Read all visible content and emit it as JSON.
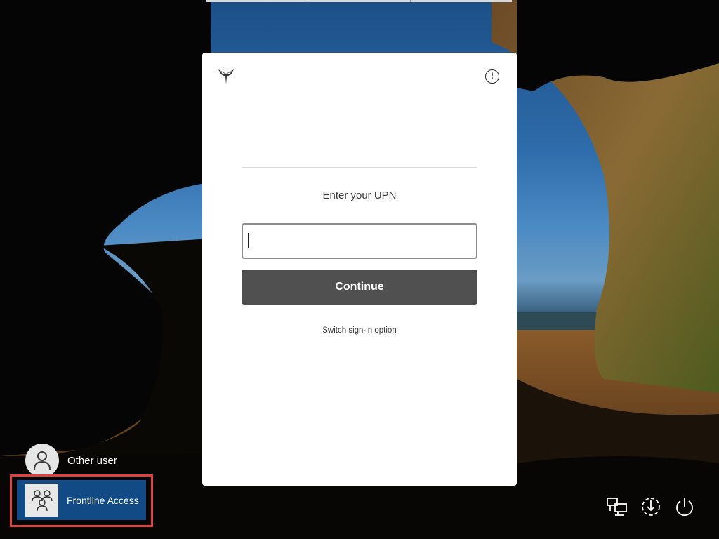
{
  "signin": {
    "prompt": "Enter your UPN",
    "upn_value": "",
    "continue_label": "Continue",
    "switch_label": "Switch sign-in option"
  },
  "users": [
    {
      "name": "Other user",
      "avatar_icon": "person-icon"
    },
    {
      "name": "Frontline Access",
      "avatar_icon": "group-icon",
      "selected": true
    }
  ],
  "system_icons": [
    "network-icon",
    "accessibility-icon",
    "power-icon"
  ],
  "colors": {
    "button_bg": "#505050",
    "selected_user_bg": "#124a86",
    "highlight_border": "#e0413a",
    "card_bg": "#ffffff"
  }
}
